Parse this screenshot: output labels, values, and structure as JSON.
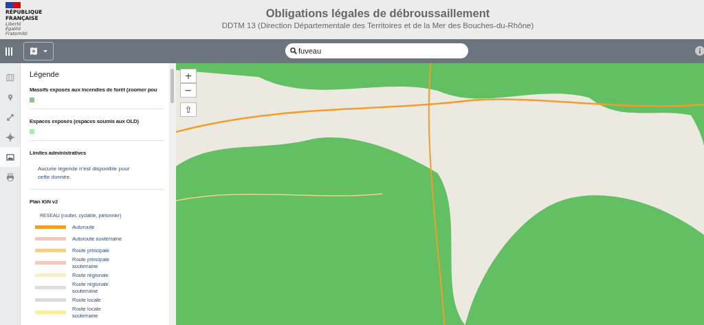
{
  "header": {
    "logo_lines": [
      "RÉPUBLIQUE",
      "FRANÇAISE"
    ],
    "motto": [
      "Liberté",
      "Égalité",
      "Fraternité"
    ],
    "title": "Obligations légales de débroussaillement",
    "subtitle": "DDTM 13 (Direction Départementale des Territoires et de la Mer des Bouches-du-Rhône)"
  },
  "toolbar": {
    "search": {
      "value": "fuveau"
    }
  },
  "rail": [
    {
      "kind": "map",
      "selected": false
    },
    {
      "kind": "pin",
      "selected": false
    },
    {
      "kind": "expand",
      "selected": false
    },
    {
      "kind": "crosshair",
      "selected": false
    },
    {
      "kind": "image",
      "selected": true
    },
    {
      "kind": "print",
      "selected": false
    }
  ],
  "legend": {
    "title": "Légende",
    "layers": [
      {
        "kind": "swatch",
        "name": "Massifs exposés aux incendies de forêt (zoomer pou",
        "color": "#8cc28c"
      },
      {
        "kind": "swatch",
        "name": "Espaces exposés (espaces soumis aux OLD)",
        "color": "#a6f0a6"
      },
      {
        "kind": "note",
        "name": "Limites administratives",
        "note": "Aucune légende n’est disponible pour cette donnée."
      },
      {
        "kind": "lines",
        "name": "Plan IGN v2",
        "subtitle": "RESEAU (routier, cyclable, piétonnier)",
        "items": [
          {
            "label": "Autoroute",
            "color": "#f39c2a"
          },
          {
            "label": "Autoroute souterraine",
            "color": "#f7c4b8"
          },
          {
            "label": "Route principale",
            "color": "#f4d08a"
          },
          {
            "label": "Route principale souterraine",
            "color": "#f6c8bc"
          },
          {
            "label": "Route régionale",
            "color": "#f8edc8"
          },
          {
            "label": "Route régionale souterraine",
            "color": "#dedede"
          },
          {
            "label": "Route locale",
            "color": "#d9d9d9"
          },
          {
            "label": "Route locale souterraine",
            "color": "#f6ee9a"
          }
        ]
      }
    ]
  },
  "map": {
    "controls": [
      "+",
      "−",
      "⇧"
    ]
  }
}
